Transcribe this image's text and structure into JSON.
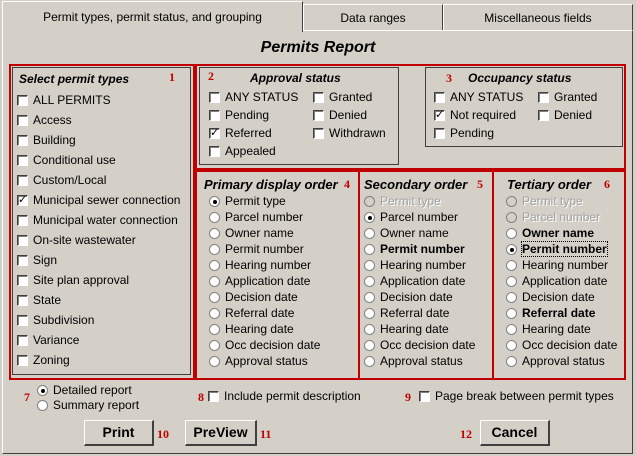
{
  "tabs": [
    {
      "label": "Permit types, permit status, and grouping"
    },
    {
      "label": "Data ranges"
    },
    {
      "label": "Miscellaneous fields"
    }
  ],
  "page_title": "Permits Report",
  "permit_types": {
    "header": "Select permit types",
    "number": "1",
    "items": [
      {
        "label": "ALL PERMITS",
        "checked": false
      },
      {
        "label": "Access",
        "checked": false
      },
      {
        "label": "Building",
        "checked": false
      },
      {
        "label": "Conditional use",
        "checked": false
      },
      {
        "label": "Custom/Local",
        "checked": false
      },
      {
        "label": "Municipal sewer connection",
        "checked": true
      },
      {
        "label": "Municipal water connection",
        "checked": false
      },
      {
        "label": "On-site wastewater",
        "checked": false
      },
      {
        "label": "Sign",
        "checked": false
      },
      {
        "label": "Site plan approval",
        "checked": false
      },
      {
        "label": "State",
        "checked": false
      },
      {
        "label": "Subdivision",
        "checked": false
      },
      {
        "label": "Variance",
        "checked": false
      },
      {
        "label": "Zoning",
        "checked": false
      }
    ]
  },
  "approval_status": {
    "header": "Approval status",
    "number": "2",
    "col1": [
      {
        "label": "ANY STATUS",
        "checked": false
      },
      {
        "label": "Pending",
        "checked": false
      },
      {
        "label": "Referred",
        "checked": true
      },
      {
        "label": "Appealed",
        "checked": false
      }
    ],
    "col2": [
      {
        "label": "Granted",
        "checked": false
      },
      {
        "label": "Denied",
        "checked": false
      },
      {
        "label": "Withdrawn",
        "checked": false
      }
    ]
  },
  "occupancy_status": {
    "header": "Occupancy status",
    "number": "3",
    "col1": [
      {
        "label": "ANY STATUS",
        "checked": false
      },
      {
        "label": "Not required",
        "checked": true
      },
      {
        "label": "Pending",
        "checked": false
      }
    ],
    "col2": [
      {
        "label": "Granted",
        "checked": false
      },
      {
        "label": "Denied",
        "checked": false
      }
    ]
  },
  "primary_order": {
    "header": "Primary display order",
    "number": "4",
    "options": [
      "Permit type",
      "Parcel number",
      "Owner name",
      "Permit number",
      "Hearing number",
      "Application date",
      "Decision date",
      "Referral date",
      "Hearing date",
      "Occ decision date",
      "Approval status"
    ]
  },
  "secondary_order": {
    "header": "Secondary order",
    "number": "5",
    "options": [
      "Permit type",
      "Parcel number",
      "Owner name",
      "Permit number",
      "Hearing number",
      "Application date",
      "Decision date",
      "Referral date",
      "Hearing date",
      "Occ decision date",
      "Approval status"
    ]
  },
  "tertiary_order": {
    "header": "Tertiary order",
    "number": "6",
    "options": [
      "Permit type",
      "Parcel number",
      "Owner name",
      "Permit number",
      "Hearing number",
      "Application date",
      "Decision date",
      "Referral date",
      "Hearing date",
      "Occ decision date",
      "Approval status"
    ]
  },
  "report_type": {
    "number": "7",
    "detailed": "Detailed report",
    "summary": "Summary report"
  },
  "include_description": {
    "number": "8",
    "label": "Include permit description"
  },
  "page_break": {
    "number": "9",
    "label": "Page break between permit types"
  },
  "buttons": {
    "print": {
      "label": "Print",
      "number": "10"
    },
    "preview": {
      "label": "PreView",
      "number": "11"
    },
    "cancel": {
      "label": "Cancel",
      "number": "12"
    }
  }
}
